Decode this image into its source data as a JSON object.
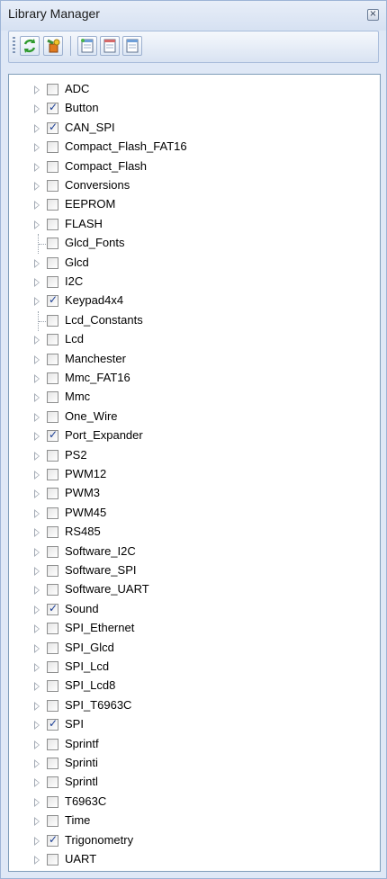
{
  "title": "Library Manager",
  "libraries": [
    {
      "label": "ADC",
      "checked": false,
      "expandable": true
    },
    {
      "label": "Button",
      "checked": true,
      "expandable": true
    },
    {
      "label": "CAN_SPI",
      "checked": true,
      "expandable": true
    },
    {
      "label": "Compact_Flash_FAT16",
      "checked": false,
      "expandable": true
    },
    {
      "label": "Compact_Flash",
      "checked": false,
      "expandable": true
    },
    {
      "label": "Conversions",
      "checked": false,
      "expandable": true
    },
    {
      "label": "EEPROM",
      "checked": false,
      "expandable": true
    },
    {
      "label": "FLASH",
      "checked": false,
      "expandable": true
    },
    {
      "label": "Glcd_Fonts",
      "checked": false,
      "expandable": false
    },
    {
      "label": "Glcd",
      "checked": false,
      "expandable": true
    },
    {
      "label": "I2C",
      "checked": false,
      "expandable": true
    },
    {
      "label": "Keypad4x4",
      "checked": true,
      "expandable": true
    },
    {
      "label": "Lcd_Constants",
      "checked": false,
      "expandable": false
    },
    {
      "label": "Lcd",
      "checked": false,
      "expandable": true
    },
    {
      "label": "Manchester",
      "checked": false,
      "expandable": true
    },
    {
      "label": "Mmc_FAT16",
      "checked": false,
      "expandable": true
    },
    {
      "label": "Mmc",
      "checked": false,
      "expandable": true
    },
    {
      "label": "One_Wire",
      "checked": false,
      "expandable": true
    },
    {
      "label": "Port_Expander",
      "checked": true,
      "expandable": true
    },
    {
      "label": "PS2",
      "checked": false,
      "expandable": true
    },
    {
      "label": "PWM12",
      "checked": false,
      "expandable": true
    },
    {
      "label": "PWM3",
      "checked": false,
      "expandable": true
    },
    {
      "label": "PWM45",
      "checked": false,
      "expandable": true
    },
    {
      "label": "RS485",
      "checked": false,
      "expandable": true
    },
    {
      "label": "Software_I2C",
      "checked": false,
      "expandable": true
    },
    {
      "label": "Software_SPI",
      "checked": false,
      "expandable": true
    },
    {
      "label": "Software_UART",
      "checked": false,
      "expandable": true
    },
    {
      "label": "Sound",
      "checked": true,
      "expandable": true
    },
    {
      "label": "SPI_Ethernet",
      "checked": false,
      "expandable": true
    },
    {
      "label": "SPI_Glcd",
      "checked": false,
      "expandable": true
    },
    {
      "label": "SPI_Lcd",
      "checked": false,
      "expandable": true
    },
    {
      "label": "SPI_Lcd8",
      "checked": false,
      "expandable": true
    },
    {
      "label": "SPI_T6963C",
      "checked": false,
      "expandable": true
    },
    {
      "label": "SPI",
      "checked": true,
      "expandable": true
    },
    {
      "label": "Sprintf",
      "checked": false,
      "expandable": true
    },
    {
      "label": "Sprinti",
      "checked": false,
      "expandable": true
    },
    {
      "label": "Sprintl",
      "checked": false,
      "expandable": true
    },
    {
      "label": "T6963C",
      "checked": false,
      "expandable": true
    },
    {
      "label": "Time",
      "checked": false,
      "expandable": true
    },
    {
      "label": "Trigonometry",
      "checked": true,
      "expandable": true
    },
    {
      "label": "UART",
      "checked": false,
      "expandable": true
    }
  ],
  "toolbar": {
    "buttons": [
      {
        "icon": "refresh-icon"
      },
      {
        "icon": "add-library-icon"
      },
      {
        "icon": "new-document-icon"
      },
      {
        "icon": "open-document-icon"
      },
      {
        "icon": "save-document-icon"
      }
    ]
  },
  "colors": {
    "panel_bg": "#dfe8f6",
    "check": "#1c3f95"
  }
}
